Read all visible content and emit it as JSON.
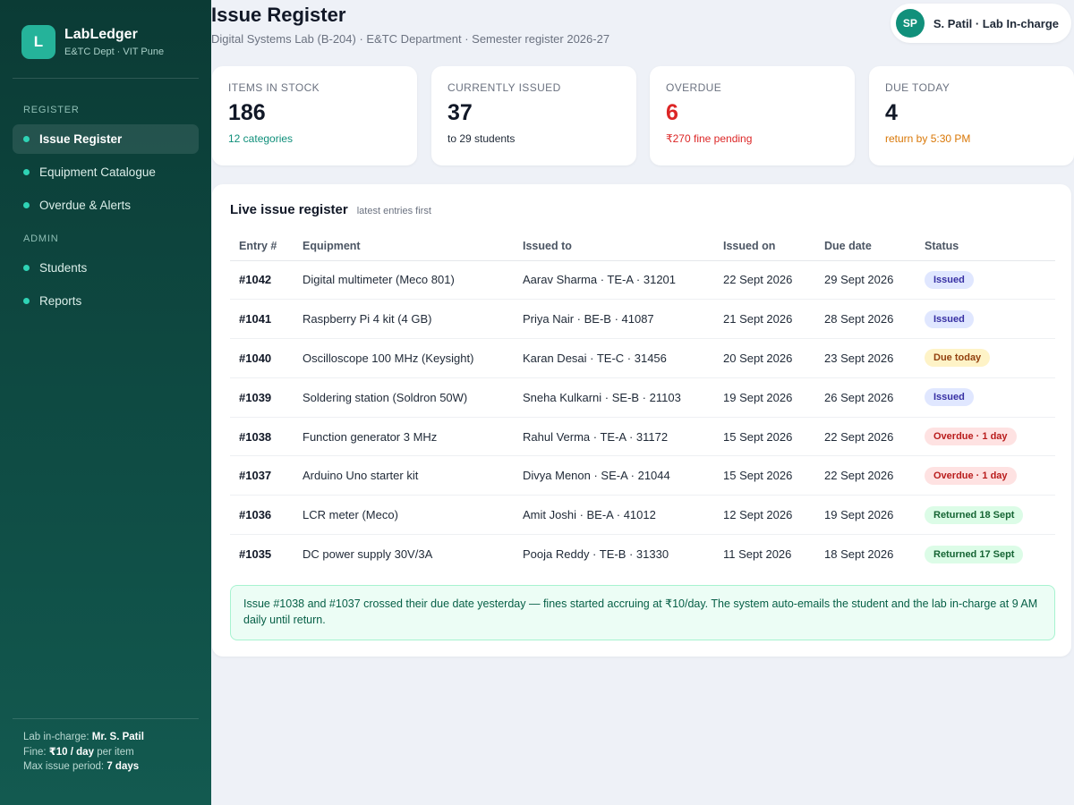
{
  "sidebar": {
    "logo_letter": "L",
    "brand_name": "LabLedger",
    "brand_sub": "E&TC Dept · VIT Pune",
    "section_register": "REGISTER",
    "section_admin": "ADMIN",
    "items": [
      {
        "label": "Issue Register",
        "active": true
      },
      {
        "label": "Equipment Catalogue",
        "active": false
      },
      {
        "label": "Overdue & Alerts",
        "active": false
      },
      {
        "label": "Students",
        "active": false
      },
      {
        "label": "Reports",
        "active": false
      }
    ],
    "footer": {
      "incharge_label": "Lab in-charge:",
      "incharge_value": "Mr. S. Patil",
      "fine_label": "Fine:",
      "fine_value": "₹10 / day",
      "fine_suffix": "per item",
      "period_label": "Max issue period:",
      "period_value": "7 days"
    }
  },
  "header": {
    "title": "Issue Register",
    "subtitle": "Digital Systems Lab (B-204) · E&TC Department · Semester register 2026-27",
    "user_initials": "SP",
    "user_name": "S. Patil · Lab In-charge"
  },
  "stats": [
    {
      "label": "ITEMS IN STOCK",
      "value": "186",
      "note": "12 categories",
      "note_color": "#0f8f7a",
      "value_color": "#111827"
    },
    {
      "label": "CURRENTLY ISSUED",
      "value": "37",
      "note": "to 29 students",
      "note_color": "#1f2937",
      "value_color": "#111827"
    },
    {
      "label": "OVERDUE",
      "value": "6",
      "note": "₹270 fine pending",
      "note_color": "#dc2626",
      "value_color": "#dc2626"
    },
    {
      "label": "DUE TODAY",
      "value": "4",
      "note": "return by 5:30 PM",
      "note_color": "#d97706",
      "value_color": "#111827"
    }
  ],
  "register": {
    "title": "Live issue register",
    "hint": "latest entries first",
    "columns": [
      "Entry #",
      "Equipment",
      "Issued to",
      "Issued on",
      "Due date",
      "Status"
    ],
    "rows": [
      {
        "entry": "#1042",
        "equipment": "Digital multimeter (Meco 801)",
        "issued_to": "Aarav Sharma · TE-A · 31201",
        "issued_on": "22 Sept 2026",
        "due": "29 Sept 2026",
        "status": "Issued",
        "status_type": "issued"
      },
      {
        "entry": "#1041",
        "equipment": "Raspberry Pi 4 kit (4 GB)",
        "issued_to": "Priya Nair · BE-B · 41087",
        "issued_on": "21 Sept 2026",
        "due": "28 Sept 2026",
        "status": "Issued",
        "status_type": "issued"
      },
      {
        "entry": "#1040",
        "equipment": "Oscilloscope 100 MHz (Keysight)",
        "issued_to": "Karan Desai · TE-C · 31456",
        "issued_on": "20 Sept 2026",
        "due": "23 Sept 2026",
        "status": "Due today",
        "status_type": "due"
      },
      {
        "entry": "#1039",
        "equipment": "Soldering station (Soldron 50W)",
        "issued_to": "Sneha Kulkarni · SE-B · 21103",
        "issued_on": "19 Sept 2026",
        "due": "26 Sept 2026",
        "status": "Issued",
        "status_type": "issued"
      },
      {
        "entry": "#1038",
        "equipment": "Function generator 3 MHz",
        "issued_to": "Rahul Verma · TE-A · 31172",
        "issued_on": "15 Sept 2026",
        "due": "22 Sept 2026",
        "status": "Overdue · 1 day",
        "status_type": "overdue"
      },
      {
        "entry": "#1037",
        "equipment": "Arduino Uno starter kit",
        "issued_to": "Divya Menon · SE-A · 21044",
        "issued_on": "15 Sept 2026",
        "due": "22 Sept 2026",
        "status": "Overdue · 1 day",
        "status_type": "overdue"
      },
      {
        "entry": "#1036",
        "equipment": "LCR meter (Meco)",
        "issued_to": "Amit Joshi · BE-A · 41012",
        "issued_on": "12 Sept 2026",
        "due": "19 Sept 2026",
        "status": "Returned 18 Sept",
        "status_type": "returned"
      },
      {
        "entry": "#1035",
        "equipment": "DC power supply 30V/3A",
        "issued_to": "Pooja Reddy · TE-B · 31330",
        "issued_on": "11 Sept 2026",
        "due": "18 Sept 2026",
        "status": "Returned 17 Sept",
        "status_type": "returned"
      }
    ],
    "notice": "Issue #1038 and #1037 crossed their due date yesterday — fines started accruing at ₹10/day. The system auto-emails the student and the lab in-charge at 9 AM daily until return."
  }
}
